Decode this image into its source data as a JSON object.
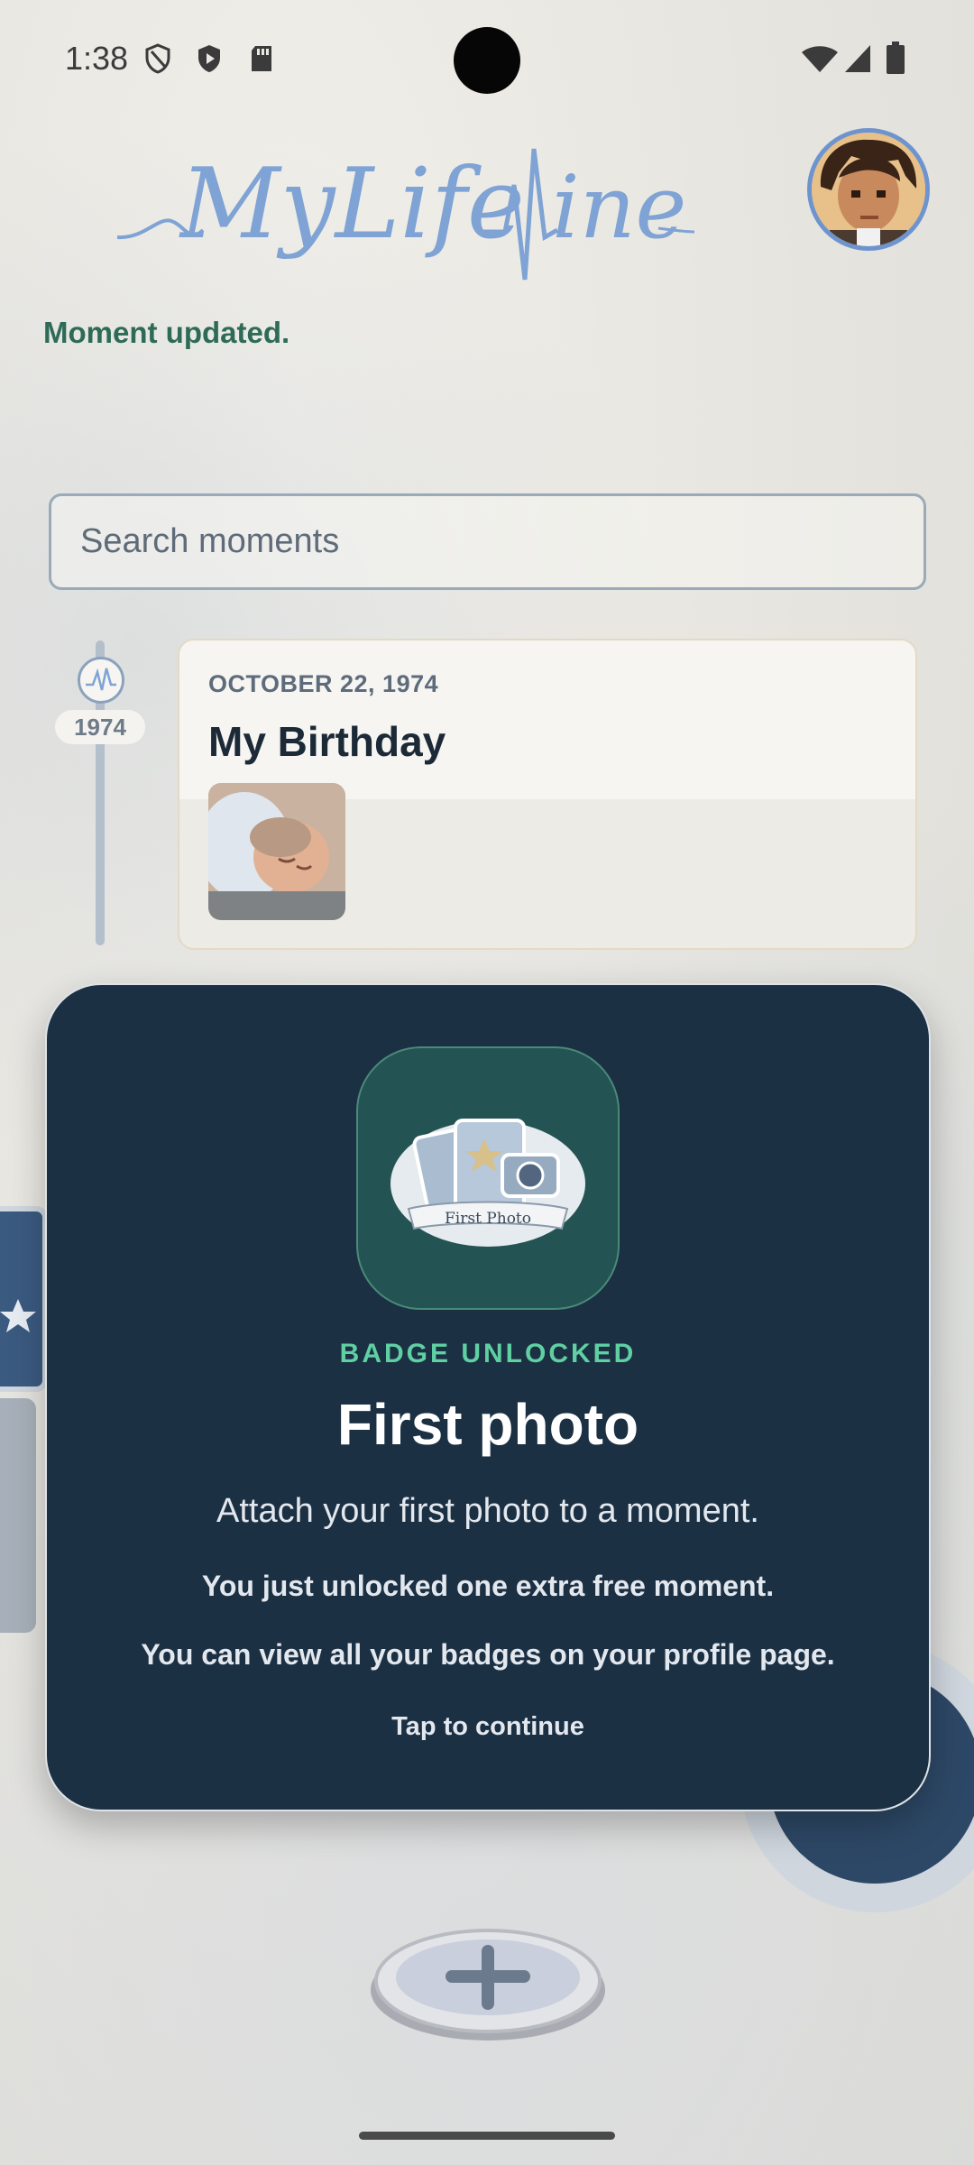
{
  "status_bar": {
    "time": "1:38"
  },
  "header": {
    "logo_text": "MyLifeLine"
  },
  "toast": {
    "message": "Moment updated."
  },
  "search": {
    "placeholder": "Search moments",
    "value": ""
  },
  "timeline": {
    "moments": [
      {
        "year": "1974",
        "date": "OCTOBER 22, 1974",
        "title": "My Birthday"
      }
    ]
  },
  "badge_dialog": {
    "kicker": "BADGE UNLOCKED",
    "badge_art_label": "First Photo",
    "title": "First photo",
    "description": "Attach your first photo to a moment.",
    "reward": "You just unlocked one extra free moment.",
    "profile_hint": "You can view all your badges on your profile page.",
    "continue_label": "Tap to continue"
  },
  "colors": {
    "dialog_bg": "#1c3044",
    "kicker": "#5fd0a2",
    "toast": "#2e6b57",
    "badge_tile": "#235353"
  }
}
